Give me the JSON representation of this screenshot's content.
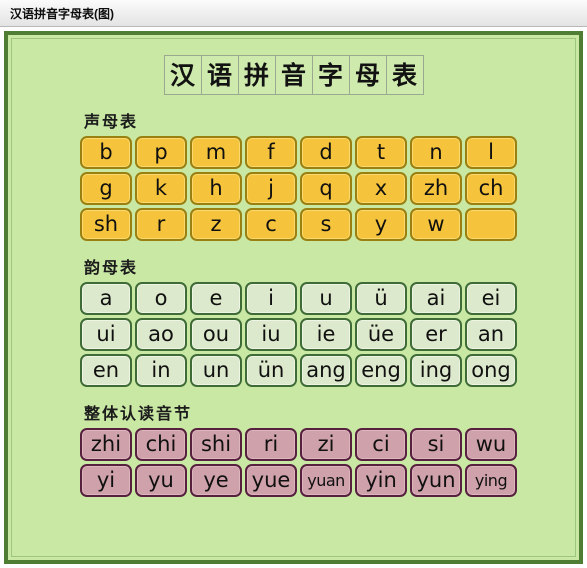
{
  "window": {
    "title": "汉语拼音字母表(图)"
  },
  "poster": {
    "heading_chars": [
      "汉",
      "语",
      "拼",
      "音",
      "字",
      "母",
      "表"
    ],
    "sections": [
      {
        "id": "initials",
        "title": "声母表",
        "style": "initial",
        "rows": [
          [
            "b",
            "p",
            "m",
            "f",
            "d",
            "t",
            "n",
            "l"
          ],
          [
            "g",
            "k",
            "h",
            "j",
            "q",
            "x",
            "zh",
            "ch"
          ],
          [
            "sh",
            "r",
            "z",
            "c",
            "s",
            "y",
            "w",
            ""
          ]
        ]
      },
      {
        "id": "finals",
        "title": "韵母表",
        "style": "final",
        "rows": [
          [
            "a",
            "o",
            "e",
            "i",
            "u",
            "ü",
            "ai",
            "ei"
          ],
          [
            "ui",
            "ao",
            "ou",
            "iu",
            "ie",
            "üe",
            "er",
            "an"
          ],
          [
            "en",
            "in",
            "un",
            "ün",
            "ang",
            "eng",
            "ing",
            "ong"
          ]
        ]
      },
      {
        "id": "whole-syllables",
        "title": "整体认读音节",
        "style": "syllable",
        "rows": [
          [
            "zhi",
            "chi",
            "shi",
            "ri",
            "zi",
            "ci",
            "si",
            "wu"
          ],
          [
            "yi",
            "yu",
            "ye",
            "yue",
            "yuan",
            "yin",
            "yun",
            "ying"
          ]
        ]
      }
    ]
  },
  "colors": {
    "page_background": "#c9e8a4",
    "frame_border": "#4e7d33",
    "initial_fill": "#f5c43c",
    "initial_border": "#9a8010",
    "final_fill": "#dde9cc",
    "final_border": "#3f6b36",
    "syllable_fill": "#cfa1aa",
    "syllable_border": "#57203f",
    "titlebar_background": "#eeeeee"
  }
}
